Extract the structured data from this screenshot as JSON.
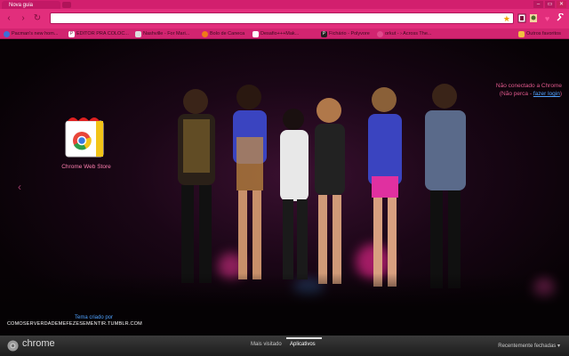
{
  "browser": {
    "tab_title": "Nova guia",
    "window_controls": [
      "–",
      "▭",
      "✕"
    ]
  },
  "toolbar": {
    "back_icon": "‹",
    "forward_icon": "›",
    "reload_icon": "↻",
    "omnibox_value": "",
    "star_icon": "★"
  },
  "bookmarks": {
    "items": [
      {
        "label": "Pacman's new hom...",
        "icon_color": "#3b6fd8"
      },
      {
        "label": "EDITOR PRA COLOC...",
        "icon_color": "#ffffff"
      },
      {
        "label": "Nashville - For Mari...",
        "icon_color": "#dddddd"
      },
      {
        "label": "Bolo de Caneca",
        "icon_color": "#f07a18"
      },
      {
        "label": "Desafio+++Mak...",
        "icon_color": "#ffffff"
      },
      {
        "label": "Fichário - Polyvore",
        "icon_color": "#222222"
      },
      {
        "label": "orkut - › Across The...",
        "icon_color": "#e04a8c"
      }
    ],
    "other_label": "Outros favoritos"
  },
  "signin": {
    "line1": "Não conectado a Chrome",
    "line2_prefix": "(Não perca - ",
    "line2_link": "fazer login",
    "line2_suffix": ")"
  },
  "apps": [
    {
      "name": "Chrome Web Store"
    }
  ],
  "theme_credit": {
    "line1": "Tema criado por",
    "line2": "COMOSERVERDADEMEFEZESEMENTIR.TUMBLR.COM"
  },
  "footer": {
    "brand": "chrome",
    "tabs": [
      {
        "label": "Mais visitado",
        "selected": false
      },
      {
        "label": "Aplicativos",
        "selected": true
      }
    ],
    "recently_closed": "Recentemente fechadas ▾"
  },
  "colors": {
    "accent": "#e22e7c",
    "link": "#4fa2ff"
  }
}
